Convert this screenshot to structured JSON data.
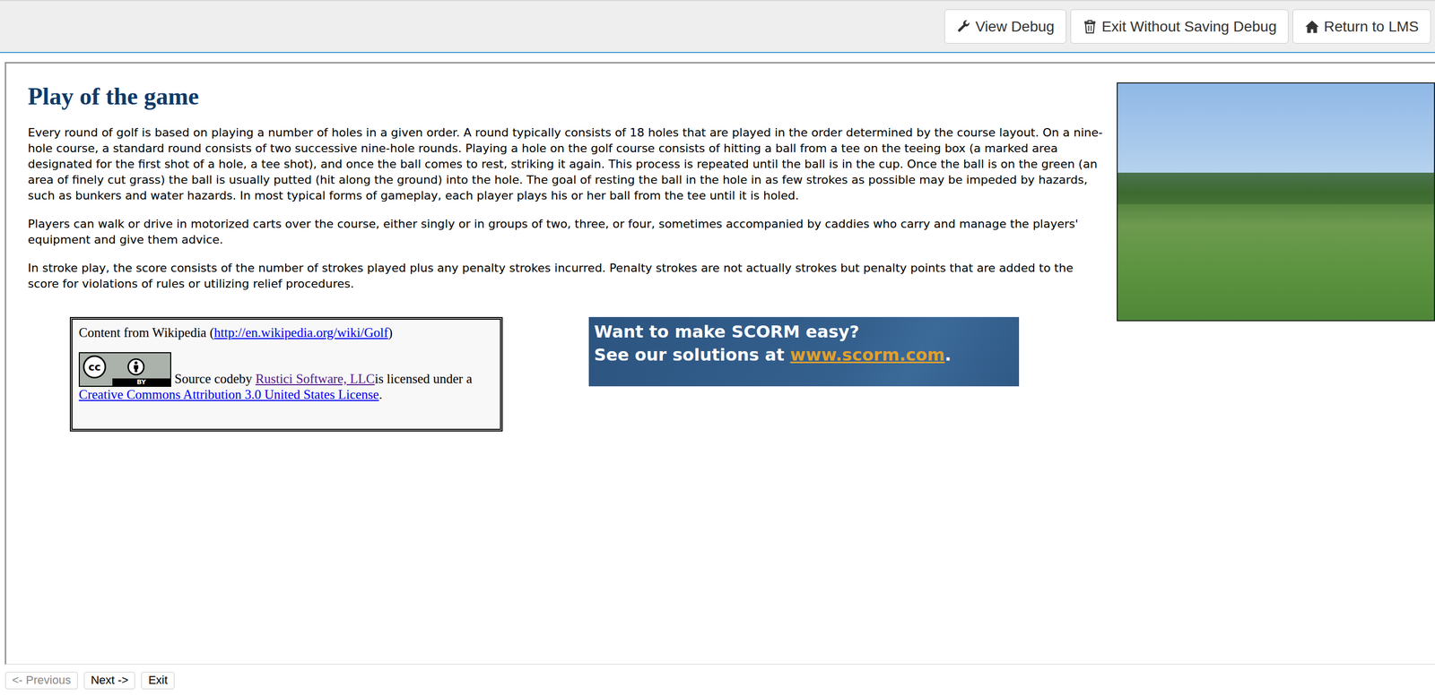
{
  "toolbar": {
    "buttons": [
      {
        "label": "View Debug",
        "kind": "wrench"
      },
      {
        "label": "Exit Without Saving Debug",
        "kind": "trash"
      },
      {
        "label": "Return to LMS",
        "kind": "home"
      }
    ]
  },
  "page": {
    "heading": "Play of the game",
    "paragraphs": [
      "Every round of golf is based on playing a number of holes in a given order. A round typically consists of 18 holes that are played in the order determined by the course layout. On a nine-hole course, a standard round consists of two successive nine-hole rounds. Playing a hole on the golf course consists of hitting a ball from a tee on the teeing box (a marked area designated for the first shot of a hole, a tee shot), and once the ball comes to rest, striking it again. This process is repeated until the ball is in the cup. Once the ball is on the green (an area of finely cut grass) the ball is usually putted (hit along the ground) into the hole. The goal of resting the ball in the hole in as few strokes as possible may be impeded by hazards, such as bunkers and water hazards. In most typical forms of gameplay, each player plays his or her ball from the tee until it is holed.",
      "Players can walk or drive in motorized carts over the course, either singly or in groups of two, three, or four, sometimes accompanied by caddies who carry and manage the players' equipment and give them advice.",
      "In stroke play, the score consists of the number of strokes played plus any penalty strokes incurred. Penalty strokes are not actually strokes but penalty points that are added to the score for violations of rules or utilizing relief procedures."
    ]
  },
  "credit": {
    "prefix": "Content from Wikipedia (",
    "link": "http://en.wikipedia.org/wiki/Golf",
    "suffix": ")",
    "badge": {
      "symbol": "cc",
      "label": "BY"
    },
    "source": "Source codeby ",
    "author": "Rustici Software, LLC",
    "licensed": "is licensed under a ",
    "license": "Creative Commons Attribution 3.0 United States License",
    "end": "."
  },
  "banner": {
    "line1": "Want to make SCORM easy?",
    "line2": "See our solutions at ",
    "link": "www.scorm.com",
    "end": "."
  },
  "nav": {
    "buttons": [
      {
        "label": "<- Previous",
        "disabled": true
      },
      {
        "label": "Next ->",
        "disabled": false
      },
      {
        "label": "Exit",
        "disabled": false
      }
    ]
  }
}
